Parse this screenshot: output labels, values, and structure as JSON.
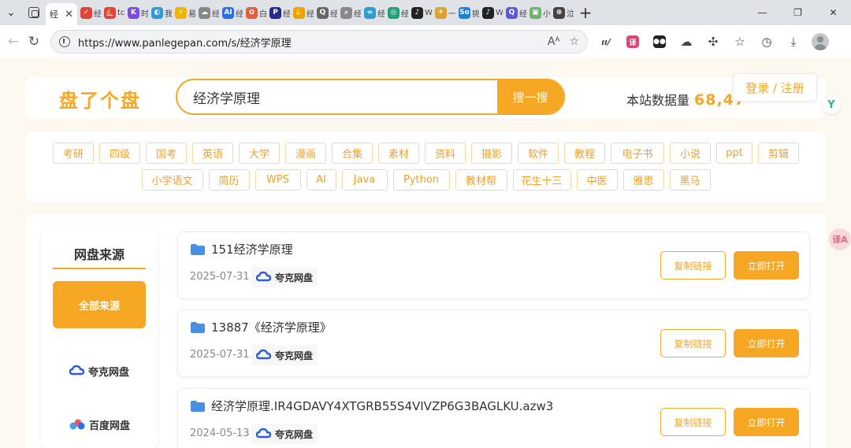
{
  "browser": {
    "active_tab": {
      "label": "经",
      "close": "✕"
    },
    "tabs": [
      {
        "icon": "tab-favicon-red-check",
        "color": "#e0443a",
        "glyph": "✓",
        "label": "经"
      },
      {
        "icon": "tab-favicon-sailboat",
        "color": "#e0443a",
        "glyph": "⛵",
        "label": "tc"
      },
      {
        "icon": "tab-favicon-ai",
        "color": "#7a4fd6",
        "glyph": "K",
        "label": "时"
      },
      {
        "icon": "tab-favicon-globe",
        "color": "#2e9bd6",
        "glyph": "◐",
        "label": "我"
      },
      {
        "icon": "tab-favicon-lightning",
        "color": "#f0b400",
        "glyph": "⚡",
        "label": "易"
      },
      {
        "icon": "tab-favicon-cloud",
        "color": "#888888",
        "glyph": "☁",
        "label": "经"
      },
      {
        "icon": "tab-favicon-ai-blue",
        "color": "#2b6de6",
        "glyph": "AI",
        "label": "经"
      },
      {
        "icon": "tab-favicon-red",
        "color": "#e06040",
        "glyph": "✿",
        "label": "白"
      },
      {
        "icon": "tab-favicon-p",
        "color": "#2a2a8a",
        "glyph": "P",
        "label": "经"
      },
      {
        "icon": "tab-favicon-hand",
        "color": "#f0a000",
        "glyph": "✋",
        "label": "经"
      },
      {
        "icon": "tab-favicon-q",
        "color": "#666666",
        "glyph": "Q",
        "label": "经"
      },
      {
        "icon": "tab-favicon-search",
        "color": "#888888",
        "glyph": "⌕",
        "label": "经"
      },
      {
        "icon": "tab-favicon-link",
        "color": "#2e9bd6",
        "glyph": "∞",
        "label": "经"
      },
      {
        "icon": "tab-favicon-circle",
        "color": "#1aa37a",
        "glyph": "◎",
        "label": "经"
      },
      {
        "icon": "tab-favicon-tiktok",
        "color": "#222222",
        "glyph": "♪",
        "label": "W"
      },
      {
        "icon": "tab-favicon-bird",
        "color": "#e0a030",
        "glyph": "✈",
        "label": "一"
      },
      {
        "icon": "tab-favicon-so",
        "color": "#1e7fd8",
        "glyph": "So",
        "label": "挑"
      },
      {
        "icon": "tab-favicon-tiktok2",
        "color": "#222222",
        "glyph": "♪",
        "label": "W"
      },
      {
        "icon": "tab-favicon-search2",
        "color": "#5b5bd6",
        "glyph": "Q",
        "label": "经"
      },
      {
        "icon": "tab-favicon-image",
        "color": "#6bb36b",
        "glyph": "▣",
        "label": "小"
      },
      {
        "icon": "tab-favicon-web",
        "color": "#444444",
        "glyph": "⊕",
        "label": "泣"
      }
    ],
    "new_tab": "+",
    "window": {
      "minimize": "—",
      "restore": "❐",
      "close": "✕"
    },
    "url": "https://www.panlegepan.com/s/经济学原理"
  },
  "site": {
    "logo": "盘了个盘",
    "search": {
      "value": "经济学原理",
      "button": "搜一搜"
    },
    "stats_label": "本站数据量",
    "stats_value": "68,47",
    "stats_tail": "·",
    "login": "登录 / 注册",
    "side_badge": "Y",
    "translate_badge": "译A"
  },
  "tags": [
    "考研",
    "四级",
    "国考",
    "英语",
    "大学",
    "漫画",
    "合集",
    "素材",
    "资料",
    "摄影",
    "软件",
    "教程",
    "电子书",
    "小说",
    "ppt",
    "剪辑",
    "小学语文",
    "简历",
    "WPS",
    "AI",
    "Java",
    "Python",
    "教材帮",
    "花生十三",
    "中医",
    "雅思",
    "黑马"
  ],
  "sidebar": {
    "title": "网盘来源",
    "all": "全部来源",
    "items": [
      "夸克网盘",
      "百度网盘"
    ]
  },
  "results": [
    {
      "title": "151经济学原理",
      "date": "2025-07-31",
      "source": "夸克网盘",
      "copy": "复制链接",
      "open": "立即打开"
    },
    {
      "title": "13887《经济学原理》",
      "date": "2025-07-31",
      "source": "夸克网盘",
      "copy": "复制链接",
      "open": "立即打开"
    },
    {
      "title": "经济学原理.IR4GDAVY4XTGRB55S4VIVZP6G3BAGLKU.azw3",
      "date": "2024-05-13",
      "source": "夸克网盘",
      "copy": "复制链接",
      "open": "立即打开"
    }
  ],
  "colors": {
    "accent": "#f5a623",
    "page_bg": "#fdf8f0",
    "tag_border": "#f3d9a8",
    "quark_blue": "#2b5fd9"
  }
}
